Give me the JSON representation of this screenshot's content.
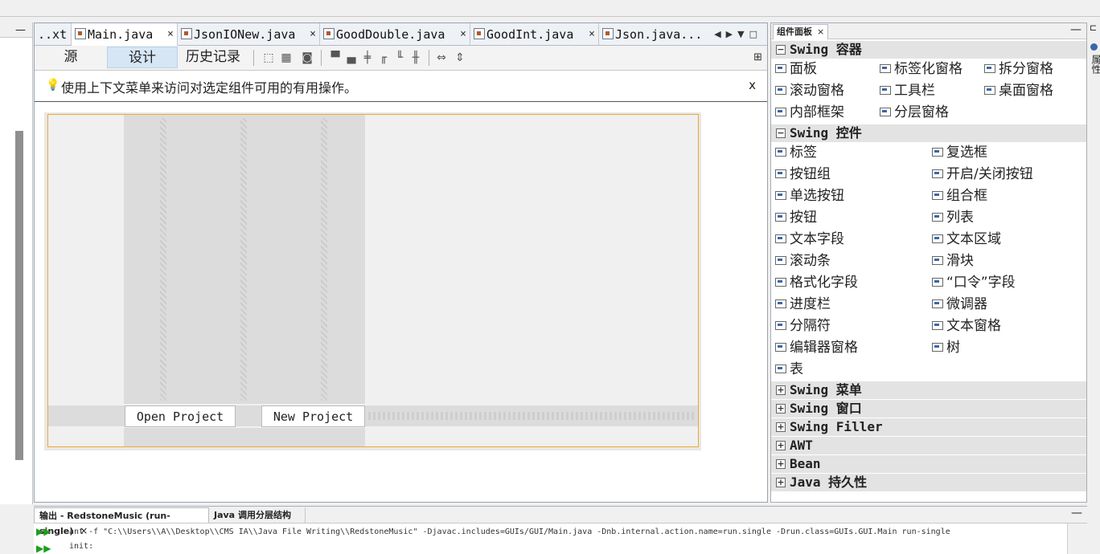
{
  "editor": {
    "tabs": [
      {
        "label": "..xt",
        "active": false
      },
      {
        "label": "Main.java",
        "active": true
      },
      {
        "label": "JsonIONew.java",
        "active": false
      },
      {
        "label": "GoodDouble.java",
        "active": false
      },
      {
        "label": "GoodInt.java",
        "active": false
      },
      {
        "label": "Json.java...",
        "active": false
      }
    ],
    "close_glyph": "×",
    "views": {
      "source": "源",
      "design": "设计",
      "history": "历史记录"
    },
    "hint": {
      "text": "使用上下文菜单来访问对选定组件可用的有用操作。",
      "close": "x"
    }
  },
  "form": {
    "buttons": {
      "open": "Open Project",
      "new": "New Project"
    }
  },
  "palette": {
    "title": "组件面板",
    "close": "×",
    "categories": {
      "containers": "Swing 容器",
      "controls": "Swing 控件",
      "menus": "Swing 菜单",
      "windows": "Swing 窗口",
      "filler": "Swing Filler",
      "awt": "AWT",
      "bean": "Bean",
      "persistence": "Java 持久性"
    },
    "container_items": [
      "面板",
      "标签化窗格",
      "拆分窗格",
      "滚动窗格",
      "工具栏",
      "桌面窗格",
      "内部框架",
      "分层窗格"
    ],
    "control_items": [
      "标签",
      "复选框",
      "按钮组",
      "开启/关闭按钮",
      "单选按钮",
      "组合框",
      "按钮",
      "列表",
      "文本字段",
      "文本区域",
      "滚动条",
      "滑块",
      "格式化字段",
      "“口令”字段",
      "进度栏",
      "微调器",
      "分隔符",
      "文本窗格",
      "编辑器窗格",
      "树",
      "表"
    ]
  },
  "right_dock": {
    "label": "属性"
  },
  "output": {
    "tabs": [
      "输出 - RedstoneMusic (run-single)",
      "Java 调用分层结构"
    ],
    "lines": [
      "ant -f \"C:\\\\Users\\\\A\\\\Desktop\\\\CMS IA\\\\Java File Writing\\\\RedstoneMusic\" -Djavac.includes=GUIs/GUI/Main.java -Dnb.internal.action.name=run.single -Drun.class=GUIs.GUI.Main run-single",
      "init:"
    ]
  }
}
